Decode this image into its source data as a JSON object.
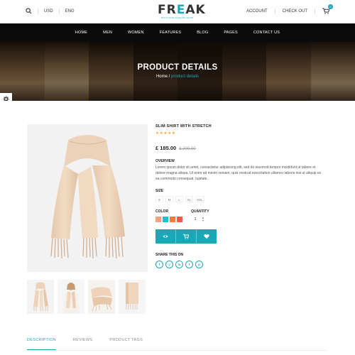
{
  "topbar": {
    "currency": "USD",
    "language": "ENG",
    "account_label": "ACCOUNT",
    "checkout_label": "CHECK OUT",
    "cart_count": "0"
  },
  "logo": {
    "text_part1": "FR",
    "text_accent": "E",
    "text_part2": "AK",
    "tagline": "BOUTIQUE FASHION SHOP"
  },
  "nav": {
    "items": [
      "HOME",
      "MEN",
      "WOMEN",
      "FEATURES",
      "BLOG",
      "PAGES",
      "CONTACT US"
    ]
  },
  "hero": {
    "title": "PRODUCT DETAILS",
    "breadcrumb_home": "Home",
    "breadcrumb_sep": " / ",
    "breadcrumb_current": "product details"
  },
  "product": {
    "title": "SLIM SHIRT WITH STRETCH",
    "stars": "★★★★★",
    "rating": 5,
    "price": "£ 185.00",
    "old_price": "£ 200.00",
    "overview_label": "OVERVIEW",
    "overview_text": "Lorem ipsum dolor sit amet, consectetur adipisicing elit, sed do eiusmod tempor incididunt ut labore et dolore magna aliqua. Ut enim ad minim veniam, quis nostrud exercitation ullamco laboris nisi ut aliquip ex ea commodo consequat. Iupitate.",
    "size_label": "SIZE",
    "sizes": [
      "S",
      "M",
      "L",
      "XL",
      "XXL"
    ],
    "color_label": "COLOR",
    "colors": [
      "#f5a27a",
      "#19c3c9",
      "#f27a3d",
      "#f05a4b"
    ],
    "quantity_label": "QUANTITY",
    "quantity_value": "1",
    "share_label": "SHARE THIS ON",
    "social_icons": [
      "facebook-icon",
      "instagram-icon",
      "linkedin-icon",
      "twitter-icon",
      "pinterest-icon"
    ]
  },
  "tabs": {
    "items": [
      "DESCRIPTION",
      "REVIEWS",
      "PRODUCT TAGS"
    ],
    "active_index": 0
  },
  "colors": {
    "accent": "#19a9b6",
    "nav_bg": "#0b0b0b",
    "star": "#f5a623"
  }
}
